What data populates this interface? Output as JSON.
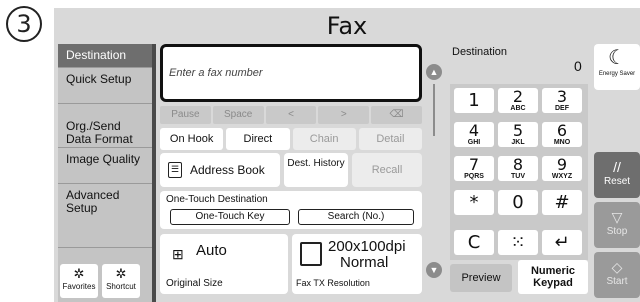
{
  "step_number": "3",
  "title": "Fax",
  "left_nav": {
    "items": [
      {
        "label": "Destination",
        "active": true
      },
      {
        "label": "Quick Setup",
        "active": false
      },
      {
        "label": "Org./Send Data Format",
        "active": false
      },
      {
        "label": "Image Quality",
        "active": false
      },
      {
        "label": "Advanced Setup",
        "active": false
      }
    ],
    "favorites_label": "Favorites",
    "shortcut_label": "Shortcut"
  },
  "fax_input": {
    "placeholder": "Enter a fax number"
  },
  "edit_keys": [
    "Pause",
    "Space",
    "<",
    ">",
    "⌫"
  ],
  "mode_keys": [
    {
      "label": "On Hook",
      "enabled": true
    },
    {
      "label": "Direct",
      "enabled": true
    },
    {
      "label": "Chain",
      "enabled": false
    },
    {
      "label": "Detail",
      "enabled": false
    }
  ],
  "address_book_label": "Address Book",
  "dest_history_label": "Dest. History",
  "recall_label": "Recall",
  "one_touch": {
    "heading": "One-Touch Destination",
    "key_label": "One-Touch Key",
    "search_label": "Search (No.)"
  },
  "original_size": {
    "value": "Auto",
    "label": "Original Size"
  },
  "fax_resolution": {
    "value_line1": "200x100dpi",
    "value_line2": "Normal",
    "label": "Fax TX Resolution"
  },
  "destination": {
    "label": "Destination",
    "count": "0"
  },
  "keypad": [
    {
      "digit": "1",
      "letters": ""
    },
    {
      "digit": "2",
      "letters": "ABC"
    },
    {
      "digit": "3",
      "letters": "DEF"
    },
    {
      "digit": "4",
      "letters": "GHI"
    },
    {
      "digit": "5",
      "letters": "JKL"
    },
    {
      "digit": "6",
      "letters": "MNO"
    },
    {
      "digit": "7",
      "letters": "PQRS"
    },
    {
      "digit": "8",
      "letters": "TUV"
    },
    {
      "digit": "9",
      "letters": "WXYZ"
    },
    {
      "digit": "*",
      "letters": ""
    },
    {
      "digit": "0",
      "letters": ""
    },
    {
      "digit": "#",
      "letters": ""
    },
    {
      "digit": "C",
      "letters": ""
    },
    {
      "digit": "⁙",
      "letters": ""
    },
    {
      "digit": "↵",
      "letters": ""
    }
  ],
  "preview_label": "Preview",
  "numeric_keypad_label_1": "Numeric",
  "numeric_keypad_label_2": "Keypad",
  "energy_saver_label": "Energy Saver",
  "reset_label": "Reset",
  "stop_label": "Stop",
  "start_label": "Start",
  "icons": {
    "energy": "moon-icon",
    "reset": "reset-icon",
    "stop": "stop-icon",
    "start": "start-icon",
    "address_book": "address-book-icon",
    "original_size": "page-size-icon",
    "resolution": "resolution-icon",
    "scroll_up": "chevron-up-icon",
    "scroll_down": "chevron-down-icon",
    "favorites": "favorites-icon",
    "shortcut": "shortcut-icon"
  }
}
